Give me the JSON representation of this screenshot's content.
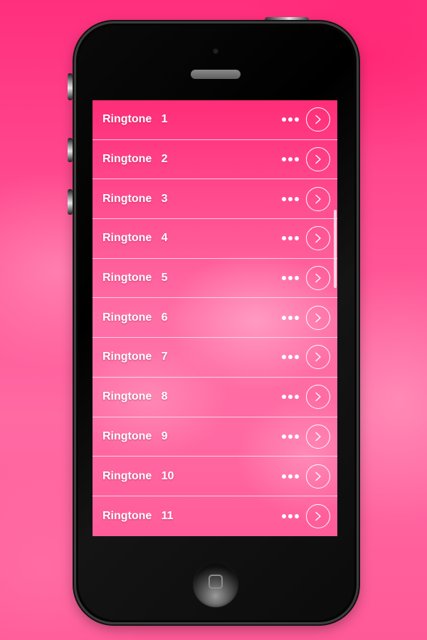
{
  "device": {
    "frame": "black smartphone",
    "colors": {
      "background_accent": "#ff3f86",
      "screen_accent": "#ff5a98",
      "row_text": "#ffffff",
      "divider": "#ffe1eb"
    }
  },
  "ringtones": {
    "items": [
      {
        "label": "Ringtone   1"
      },
      {
        "label": "Ringtone   2"
      },
      {
        "label": "Ringtone   3"
      },
      {
        "label": "Ringtone   4"
      },
      {
        "label": "Ringtone   5"
      },
      {
        "label": "Ringtone   6"
      },
      {
        "label": "Ringtone   7"
      },
      {
        "label": "Ringtone   8"
      },
      {
        "label": "Ringtone   9"
      },
      {
        "label": "Ringtone   10"
      },
      {
        "label": "Ringtone   11"
      }
    ],
    "more_icon": "more-horizontal-icon",
    "open_icon": "chevron-right-circle-icon"
  }
}
